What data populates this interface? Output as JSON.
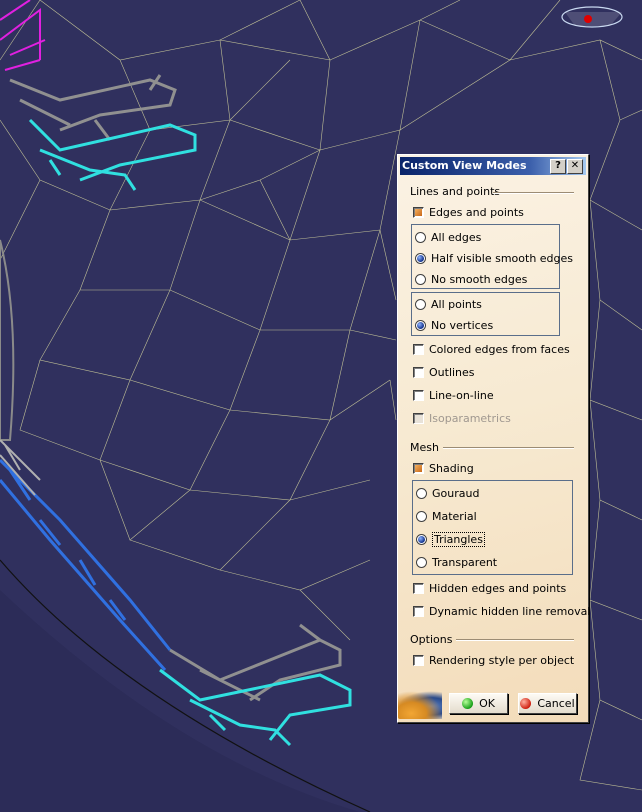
{
  "dialog": {
    "title": "Custom View Modes",
    "help_label": "?",
    "close_label": "✕",
    "lines_section": "Lines and points",
    "edges_and_points": "Edges and points",
    "edge_options": [
      "All edges",
      "Half visible smooth edges",
      "No smooth edges"
    ],
    "selected_edge": "Half visible smooth edges",
    "point_options": [
      "All points",
      "No vertices"
    ],
    "selected_point": "No vertices",
    "colored_edges": "Colored edges from faces",
    "outlines": "Outlines",
    "line_on_line": "Line-on-line",
    "isoparametrics": "Isoparametrics",
    "mesh_section": "Mesh",
    "shading": "Shading",
    "shading_options": [
      "Gouraud",
      "Material",
      "Triangles",
      "Transparent"
    ],
    "selected_shading": "Triangles",
    "hidden_edges": "Hidden edges and points",
    "dynamic_hidden": "Dynamic hidden line removal",
    "options_section": "Options",
    "rendering_style": "Rendering style per object",
    "ok_label": "OK",
    "cancel_label": "Cancel"
  },
  "colors": {
    "background": "#30305e",
    "mesh_lines": "#d8d8a0",
    "title_bar": "#0a246a",
    "part_magenta": "#e020e0",
    "part_gray": "#8a8a8a",
    "part_cyan": "#30e0e0",
    "part_blue": "#3070e0"
  },
  "icons": {
    "compass": "compass-icon",
    "ok": "green-dot-icon",
    "cancel": "red-dot-icon",
    "logo": "catia-logo-icon"
  }
}
